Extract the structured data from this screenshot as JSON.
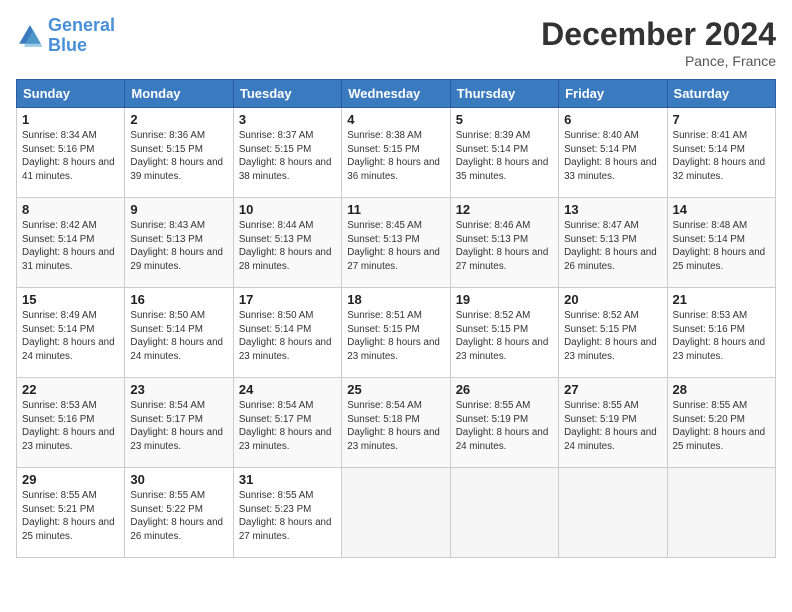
{
  "header": {
    "logo_line1": "General",
    "logo_line2": "Blue",
    "month_title": "December 2024",
    "location": "Pance, France"
  },
  "columns": [
    "Sunday",
    "Monday",
    "Tuesday",
    "Wednesday",
    "Thursday",
    "Friday",
    "Saturday"
  ],
  "weeks": [
    [
      {
        "day": "1",
        "sunrise": "8:34 AM",
        "sunset": "5:16 PM",
        "daylight": "8 hours and 41 minutes."
      },
      {
        "day": "2",
        "sunrise": "8:36 AM",
        "sunset": "5:15 PM",
        "daylight": "8 hours and 39 minutes."
      },
      {
        "day": "3",
        "sunrise": "8:37 AM",
        "sunset": "5:15 PM",
        "daylight": "8 hours and 38 minutes."
      },
      {
        "day": "4",
        "sunrise": "8:38 AM",
        "sunset": "5:15 PM",
        "daylight": "8 hours and 36 minutes."
      },
      {
        "day": "5",
        "sunrise": "8:39 AM",
        "sunset": "5:14 PM",
        "daylight": "8 hours and 35 minutes."
      },
      {
        "day": "6",
        "sunrise": "8:40 AM",
        "sunset": "5:14 PM",
        "daylight": "8 hours and 33 minutes."
      },
      {
        "day": "7",
        "sunrise": "8:41 AM",
        "sunset": "5:14 PM",
        "daylight": "8 hours and 32 minutes."
      }
    ],
    [
      {
        "day": "8",
        "sunrise": "8:42 AM",
        "sunset": "5:14 PM",
        "daylight": "8 hours and 31 minutes."
      },
      {
        "day": "9",
        "sunrise": "8:43 AM",
        "sunset": "5:13 PM",
        "daylight": "8 hours and 29 minutes."
      },
      {
        "day": "10",
        "sunrise": "8:44 AM",
        "sunset": "5:13 PM",
        "daylight": "8 hours and 28 minutes."
      },
      {
        "day": "11",
        "sunrise": "8:45 AM",
        "sunset": "5:13 PM",
        "daylight": "8 hours and 27 minutes."
      },
      {
        "day": "12",
        "sunrise": "8:46 AM",
        "sunset": "5:13 PM",
        "daylight": "8 hours and 27 minutes."
      },
      {
        "day": "13",
        "sunrise": "8:47 AM",
        "sunset": "5:13 PM",
        "daylight": "8 hours and 26 minutes."
      },
      {
        "day": "14",
        "sunrise": "8:48 AM",
        "sunset": "5:14 PM",
        "daylight": "8 hours and 25 minutes."
      }
    ],
    [
      {
        "day": "15",
        "sunrise": "8:49 AM",
        "sunset": "5:14 PM",
        "daylight": "8 hours and 24 minutes."
      },
      {
        "day": "16",
        "sunrise": "8:50 AM",
        "sunset": "5:14 PM",
        "daylight": "8 hours and 24 minutes."
      },
      {
        "day": "17",
        "sunrise": "8:50 AM",
        "sunset": "5:14 PM",
        "daylight": "8 hours and 23 minutes."
      },
      {
        "day": "18",
        "sunrise": "8:51 AM",
        "sunset": "5:15 PM",
        "daylight": "8 hours and 23 minutes."
      },
      {
        "day": "19",
        "sunrise": "8:52 AM",
        "sunset": "5:15 PM",
        "daylight": "8 hours and 23 minutes."
      },
      {
        "day": "20",
        "sunrise": "8:52 AM",
        "sunset": "5:15 PM",
        "daylight": "8 hours and 23 minutes."
      },
      {
        "day": "21",
        "sunrise": "8:53 AM",
        "sunset": "5:16 PM",
        "daylight": "8 hours and 23 minutes."
      }
    ],
    [
      {
        "day": "22",
        "sunrise": "8:53 AM",
        "sunset": "5:16 PM",
        "daylight": "8 hours and 23 minutes."
      },
      {
        "day": "23",
        "sunrise": "8:54 AM",
        "sunset": "5:17 PM",
        "daylight": "8 hours and 23 minutes."
      },
      {
        "day": "24",
        "sunrise": "8:54 AM",
        "sunset": "5:17 PM",
        "daylight": "8 hours and 23 minutes."
      },
      {
        "day": "25",
        "sunrise": "8:54 AM",
        "sunset": "5:18 PM",
        "daylight": "8 hours and 23 minutes."
      },
      {
        "day": "26",
        "sunrise": "8:55 AM",
        "sunset": "5:19 PM",
        "daylight": "8 hours and 24 minutes."
      },
      {
        "day": "27",
        "sunrise": "8:55 AM",
        "sunset": "5:19 PM",
        "daylight": "8 hours and 24 minutes."
      },
      {
        "day": "28",
        "sunrise": "8:55 AM",
        "sunset": "5:20 PM",
        "daylight": "8 hours and 25 minutes."
      }
    ],
    [
      {
        "day": "29",
        "sunrise": "8:55 AM",
        "sunset": "5:21 PM",
        "daylight": "8 hours and 25 minutes."
      },
      {
        "day": "30",
        "sunrise": "8:55 AM",
        "sunset": "5:22 PM",
        "daylight": "8 hours and 26 minutes."
      },
      {
        "day": "31",
        "sunrise": "8:55 AM",
        "sunset": "5:23 PM",
        "daylight": "8 hours and 27 minutes."
      },
      null,
      null,
      null,
      null
    ]
  ]
}
